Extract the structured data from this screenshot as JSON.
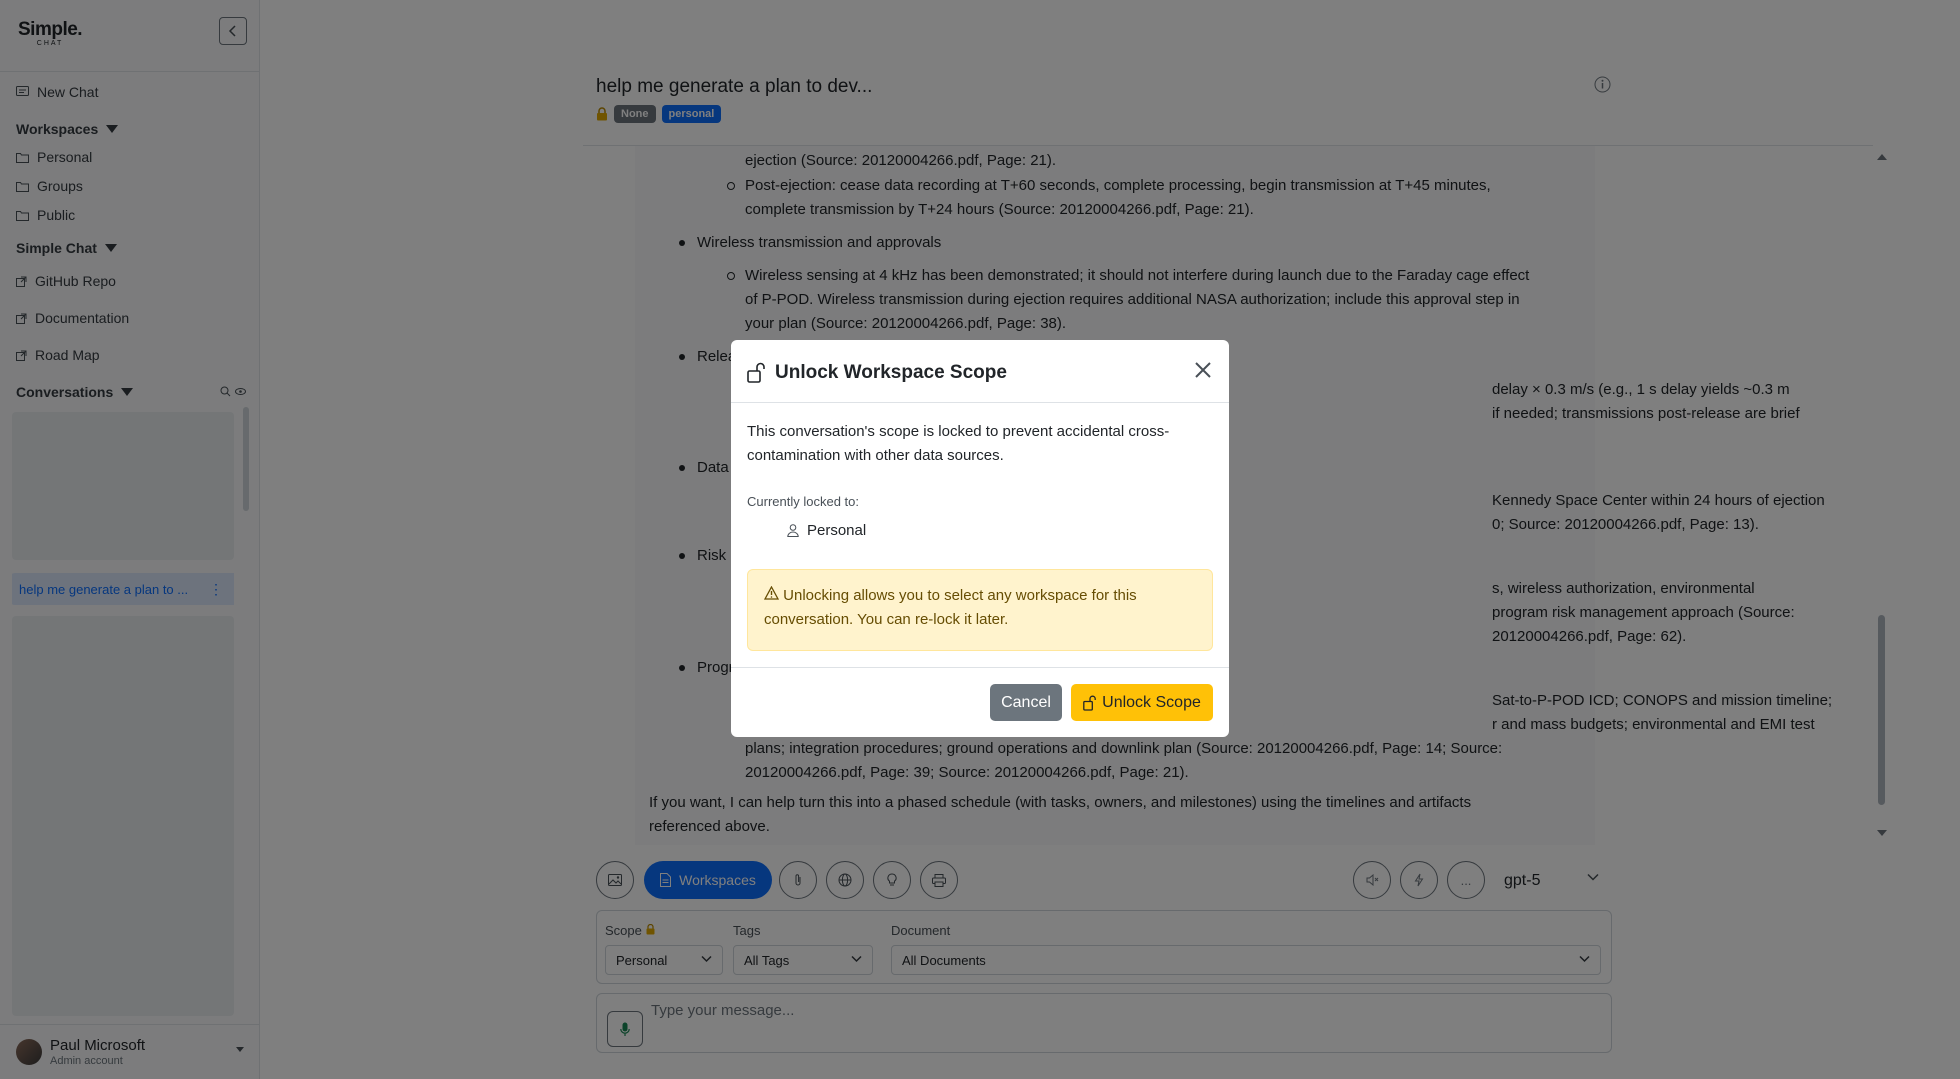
{
  "sidebar": {
    "logo_main": "Simple.",
    "logo_sub": "CHAT",
    "new_chat": "New Chat",
    "workspaces_header": "Workspaces",
    "workspaces": [
      "Personal",
      "Groups",
      "Public"
    ],
    "simple_chat_header": "Simple Chat",
    "links": [
      "GitHub Repo",
      "Documentation",
      "Road Map"
    ],
    "conversations_header": "Conversations",
    "active_conversation": "help me generate a plan to ...",
    "user_name": "Paul Microsoft",
    "user_role": "Admin account"
  },
  "header": {
    "title": "help me generate a plan to dev...",
    "badge_none": "None",
    "badge_personal": "personal"
  },
  "message": {
    "lines": [
      "ejection (Source: 20120004266.pdf, Page: 21).",
      "Post-ejection: cease data recording at T+60 seconds, complete processing, begin transmission at T+45 minutes,",
      "complete transmission by T+24 hours (Source: 20120004266.pdf, Page: 21).",
      "Wireless transmission and approvals",
      "Wireless sensing at 4 kHz has been demonstrated; it should not interfere during launch due to the Faraday cage effect",
      "of P-POD. Wireless transmission during ejection requires additional NASA authorization; include this approval step in",
      "your plan (Source: 20120004266.pdf, Page: 38).",
      "Relea",
      "delay × 0.3 m/s (e.g., 1 s delay yields ~0.3 m",
      "if needed; transmissions post-release are brief",
      "Data",
      "Kennedy Space Center within 24 hours of ejection",
      "0; Source: 20120004266.pdf, Page: 13).",
      "Risk r",
      "s, wireless authorization, environmental",
      "program risk management approach (Source:",
      "20120004266.pdf, Page: 62).",
      "Progr",
      "Sat-to-P-POD ICD; CONOPS and mission timeline;",
      "r and mass budgets; environmental and EMI test",
      "plans; integration procedures; ground operations and downlink plan (Source: 20120004266.pdf, Page: 14; Source:",
      "20120004266.pdf, Page: 39; Source: 20120004266.pdf, Page: 21).",
      "If you want, I can help turn this into a phased schedule (with tasks, owners, and milestones) using the timelines and artifacts",
      "referenced above."
    ]
  },
  "toolbar": {
    "workspaces_label": "Workspaces",
    "model": "gpt-5",
    "more_label": "..."
  },
  "scope": {
    "scope_label": "Scope",
    "scope_value": "Personal",
    "tags_label": "Tags",
    "tags_value": "All Tags",
    "doc_label": "Document",
    "doc_value": "All Documents"
  },
  "input": {
    "placeholder": "Type your message..."
  },
  "modal": {
    "title": "Unlock Workspace Scope",
    "desc_line1": "This conversation's scope is locked to prevent accidental cross-",
    "desc_line2": "contamination with other data sources.",
    "currently_locked": "Currently locked to:",
    "locked_scope": "Personal",
    "alert_line1": "Unlocking allows you to select any workspace for this",
    "alert_line2": "conversation. You can re-lock it later.",
    "cancel": "Cancel",
    "unlock": "Unlock Scope"
  },
  "colors": {
    "primary": "#0d6efd",
    "warning": "#ffc107",
    "secondary": "#6c757d",
    "alert_bg": "#fff3cd"
  }
}
